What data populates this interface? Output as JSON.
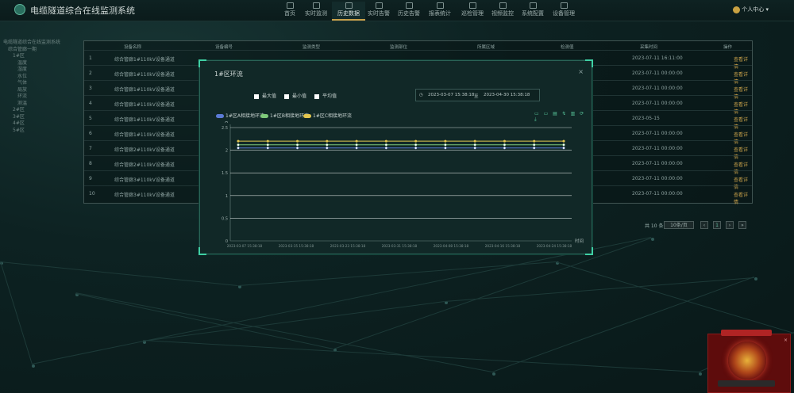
{
  "header": {
    "title": "电缆隧道综合在线监测系统",
    "nav": [
      {
        "label": "首页",
        "icon": "home-icon"
      },
      {
        "label": "实时监测",
        "icon": "monitor-icon"
      },
      {
        "label": "历史数据",
        "icon": "history-icon",
        "active": true
      },
      {
        "label": "实时告警",
        "icon": "alarm-icon"
      },
      {
        "label": "历史告警",
        "icon": "alarm-history-icon"
      },
      {
        "label": "报表统计",
        "icon": "report-icon"
      },
      {
        "label": "巡检管理",
        "icon": "inspection-icon"
      },
      {
        "label": "视频监控",
        "icon": "video-icon"
      },
      {
        "label": "系统配置",
        "icon": "config-icon"
      },
      {
        "label": "设备管理",
        "icon": "device-icon"
      }
    ],
    "user": "个人中心"
  },
  "tree": [
    "电缆隧道综合在线监测系统",
    "综合管廊一期",
    "1#区",
    "温度",
    "湿度",
    "水位",
    "气体",
    "局放",
    "环流",
    "测温",
    "2#区",
    "3#区",
    "4#区",
    "5#区"
  ],
  "table": {
    "headers": [
      "设备名称",
      "设备编号",
      "监测类型",
      "监测部位",
      "所属区域",
      "检测值",
      "采集时间",
      "操作"
    ],
    "rows": [
      {
        "idx": "1",
        "name": "综合管廊1#110kV设备通道",
        "time": "2023-07-11 16:11:00",
        "action": "查看详情"
      },
      {
        "idx": "2",
        "name": "综合管廊1#110kV设备通道",
        "time": "2023-07-11 00:00:00",
        "action": "查看详情"
      },
      {
        "idx": "3",
        "name": "综合管廊1#110kV设备通道",
        "time": "2023-07-11 00:00:00",
        "action": "查看详情"
      },
      {
        "idx": "4",
        "name": "综合管廊1#110kV设备通道",
        "time": "2023-07-11 00:00:00",
        "action": "查看详情"
      },
      {
        "idx": "5",
        "name": "综合管廊1#110kV设备通道",
        "time": "2023-05-15",
        "action": "查看详情"
      },
      {
        "idx": "6",
        "name": "综合管廊1#110kV设备通道",
        "time": "2023-07-11 00:00:00",
        "action": "查看详情"
      },
      {
        "idx": "7",
        "name": "综合管廊2#110kV设备通道",
        "time": "2023-07-11 00:00:00",
        "action": "查看详情"
      },
      {
        "idx": "8",
        "name": "综合管廊2#110kV设备通道",
        "time": "2023-07-11 00:00:00",
        "action": "查看详情"
      },
      {
        "idx": "9",
        "name": "综合管廊3#110kV设备通道",
        "time": "2023-07-11 00:00:00",
        "action": "查看详情"
      },
      {
        "idx": "10",
        "name": "综合管廊3#110kV设备通道",
        "time": "2023-07-11 00:00:00",
        "action": "查看详情"
      }
    ]
  },
  "pager": {
    "total": "共 10 条",
    "size": "10条/页",
    "page": "1"
  },
  "modal": {
    "title": "1#区环流",
    "close": "×",
    "checks": [
      "最大值",
      "最小值",
      "平均值"
    ],
    "date_start": "2023-03-07 15:38:18",
    "date_sep": "至",
    "date_end": "2023-04-30 15:38:18",
    "tools": "▭ ▭ ▤ ↯ ▥ ⟳ ⤓"
  },
  "chart_data": {
    "type": "line",
    "ylabel": "A",
    "xlabel": "时间",
    "ylim": [
      0,
      2.5
    ],
    "yticks": [
      "0",
      "0.5",
      "1",
      "1.5",
      "2",
      "2.5"
    ],
    "categories": [
      "2023-03-07 15:38",
      "2023-03-15 15:38",
      "2023-03-23 15:38",
      "2023-03-31 15:38",
      "2023-04-08 15:38",
      "2023-04-16 15:38",
      "2023-04-24 15:38"
    ],
    "x_ticks": [
      "2023-03-07 15:38:18",
      "2023-03-15 15:38:18",
      "2023-03-23 15:38:18",
      "2023-03-31 15:38:18",
      "2023-04-08 15:38:18",
      "2023-04-16 15:38:18",
      "2023-04-24 15:38:18"
    ],
    "series": [
      {
        "name": "1#区A相接地环流",
        "color": "#5b7bd5",
        "values": [
          2.05,
          2.05,
          2.05,
          2.05,
          2.05,
          2.05,
          2.05,
          2.05,
          2.05,
          2.05,
          2.05,
          2.05
        ]
      },
      {
        "name": "1#区B相接地环流",
        "color": "#7ec87a",
        "values": [
          2.12,
          2.12,
          2.12,
          2.12,
          2.12,
          2.12,
          2.12,
          2.12,
          2.12,
          2.12,
          2.12,
          2.12
        ]
      },
      {
        "name": "1#区C相接地环流",
        "color": "#e4c74f",
        "values": [
          2.2,
          2.2,
          2.2,
          2.2,
          2.2,
          2.2,
          2.2,
          2.2,
          2.2,
          2.2,
          2.2,
          2.2
        ]
      }
    ],
    "grid": true,
    "legend": "top-left"
  }
}
